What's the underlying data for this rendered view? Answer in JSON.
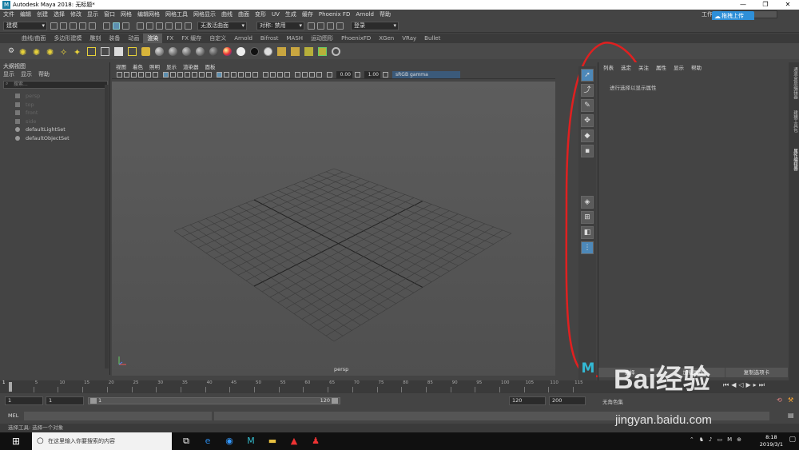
{
  "window": {
    "title": "Autodesk Maya 2018: 无标题*"
  },
  "menubar": {
    "items": [
      "文件",
      "编辑",
      "创建",
      "选择",
      "修改",
      "显示",
      "窗口",
      "网格",
      "编辑网格",
      "网格工具",
      "网格显示",
      "曲线",
      "曲面",
      "变形",
      "UV",
      "生成",
      "缓存",
      "Phoenix FD",
      "Arnold",
      "帮助"
    ],
    "workspace_label": "工作区",
    "cloud_button": "拖拽上传"
  },
  "statusline": {
    "mode": "建模",
    "live_surface": "无激活曲面",
    "symmetry": "对称: 禁用",
    "login": "登录"
  },
  "shelf": {
    "tabs": [
      "曲线/曲面",
      "多边形建模",
      "雕刻",
      "装备",
      "动画",
      "渲染",
      "FX",
      "FX 缓存",
      "自定义",
      "Arnold",
      "Bifrost",
      "MASH",
      "运动图形",
      "PhoenixFD",
      "XGen",
      "VRay",
      "Bullet"
    ],
    "active_tab": "渲染"
  },
  "outliner": {
    "title": "大纲视图",
    "menu": [
      "显示",
      "显示",
      "帮助"
    ],
    "search_placeholder": "搜索...",
    "items": [
      "persp",
      "top",
      "front",
      "side",
      "defaultLightSet",
      "defaultObjectSet"
    ]
  },
  "viewport": {
    "menu": [
      "视图",
      "着色",
      "照明",
      "显示",
      "渲染器",
      "面板"
    ],
    "exposure": "0.00",
    "gamma": "1.00",
    "color_space": "sRGB gamma",
    "camera_label": "persp"
  },
  "attribute_editor": {
    "menu": [
      "列表",
      "选定",
      "关注",
      "属性",
      "显示",
      "帮助"
    ],
    "message": "进行选择以显示属性",
    "buttons": [
      "选择",
      "加载属性",
      "复制选项卡"
    ]
  },
  "side_tabs": [
    "通道盒/层编辑器",
    "建模工具包",
    "属性编辑器"
  ],
  "timeline": {
    "ticks": [
      "5",
      "10",
      "15",
      "20",
      "25",
      "30",
      "35",
      "40",
      "45",
      "50",
      "55",
      "60",
      "65",
      "70",
      "75",
      "80",
      "85",
      "90",
      "95",
      "100",
      "105",
      "110",
      "115"
    ],
    "current_frame": "1"
  },
  "range": {
    "start": "1",
    "inner_start": "1",
    "slider_start": "1",
    "slider_end": "120",
    "end": "120",
    "anim_end": "200",
    "no_char": "无角色集"
  },
  "mel": {
    "label": "MEL"
  },
  "help_line": "选择工具: 选择一个对象",
  "taskbar": {
    "search_placeholder": "在这里输入你要搜索的内容",
    "time": "8:18",
    "date": "2019/3/1",
    "ime": "M"
  },
  "watermark": {
    "brand": "Bai经验",
    "url": "jingyan.baidu.com"
  }
}
